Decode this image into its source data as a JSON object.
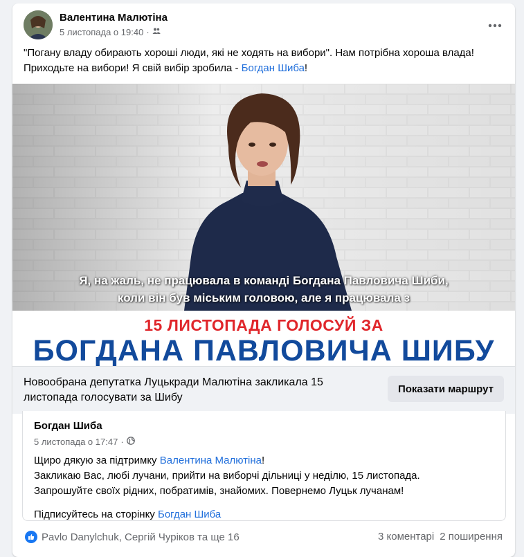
{
  "post": {
    "author": "Валентина Малютіна",
    "date": "5 листопада о 19:40",
    "audience_icon": "friends-icon",
    "text_before": "\"Погану владу обирають хороші люди, які не ходять на вибори\".  Нам потрібна хороша влада! Приходьте на вибори! Я свій вибір зробила - ",
    "text_link": "Богдан Шиба",
    "text_after": "!"
  },
  "media": {
    "caption_line1": "Я, на жаль, не працювала в команді Богдана Павловича Шиби,",
    "caption_line2": "коли він був міським головою, але я працювала з",
    "banner_line1": "15 ЛИСТОПАДА ГОЛОСУЙ ЗА",
    "banner_line2": "БОГДАНА ПАВЛОВИЧА ШИБУ"
  },
  "link_preview": {
    "title": "Новообрана депутатка Луцькради Малютіна закликала 15 листопада голосувати за Шибу",
    "button": "Показати маршрут"
  },
  "shared_post": {
    "author": "Богдан Шиба",
    "date": "5 листопада о 17:47",
    "audience_icon": "globe-icon",
    "line1_before": "Щиро дякую за підтримку ",
    "line1_link": "Валентина Малютіна",
    "line1_after": "!",
    "line2": "Закликаю Вас, любі лучани, прийти на виборчі дільниці у неділю, 15 листопада.",
    "line3": "Запрошуйте своїх рідних, побратимів, знайомих. Повернемо Луцьк лучанам!",
    "line4_before": "Підписуйтесь на сторінку ",
    "line4_link": "Богдан Шиба"
  },
  "footer": {
    "reactions": "Pavlo Danylchuk, Сергій Чуріков та ще 16",
    "comments": "3 коментарі",
    "shares": "2 поширення"
  },
  "colors": {
    "link": "#216fdb",
    "banner_red": "#e0262b",
    "banner_blue": "#124a9c",
    "like_blue": "#1877f2"
  }
}
